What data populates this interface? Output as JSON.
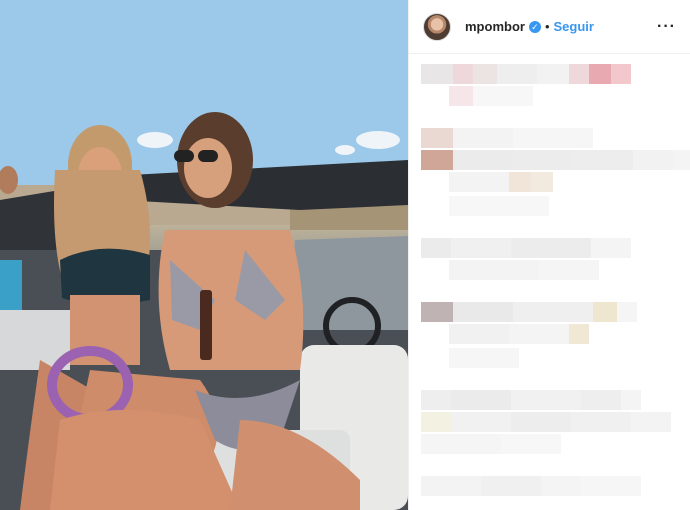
{
  "post": {
    "username": "mpombor",
    "separator": "•",
    "follow_label": "Seguir",
    "more_label": "···",
    "verified_label": "✓"
  },
  "colors": {
    "accent": "#3897f0",
    "text": "#262626",
    "border": "#efefef"
  },
  "icons": [
    "verified-badge-icon",
    "more-options-icon"
  ]
}
